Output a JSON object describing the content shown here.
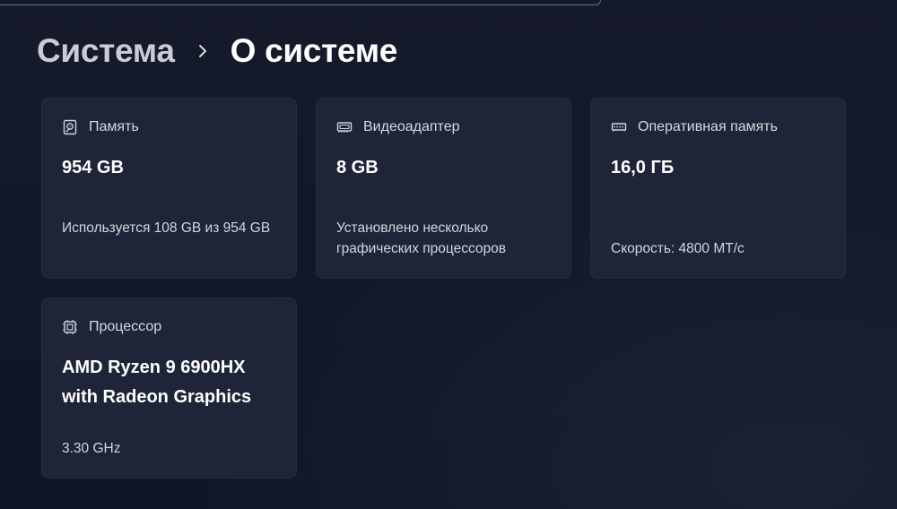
{
  "breadcrumb": {
    "parent": "Система",
    "current": "О системе"
  },
  "icons": {
    "separator": "chevron-right-icon",
    "storage": "hard-drive-icon",
    "gpu": "graphics-card-icon",
    "ram": "memory-module-icon",
    "cpu": "processor-chip-icon"
  },
  "colors": {
    "background": "#121826",
    "card": "#1f2538",
    "text_primary": "#ffffff",
    "text_secondary": "#d3d6dc"
  },
  "cards": {
    "storage": {
      "label": "Память",
      "value": "954 GB",
      "detail": "Используется 108 GB из 954 GB"
    },
    "gpu": {
      "label": "Видеоадаптер",
      "value": "8 GB",
      "detail": "Установлено несколько графических процессоров"
    },
    "ram": {
      "label": "Оперативная память",
      "value": "16,0 ГБ",
      "detail": "Скорость: 4800 MT/с"
    },
    "cpu": {
      "label": "Процессор",
      "value": "AMD Ryzen 9 6900HX with Radeon Graphics",
      "detail": "3.30 GHz"
    }
  }
}
